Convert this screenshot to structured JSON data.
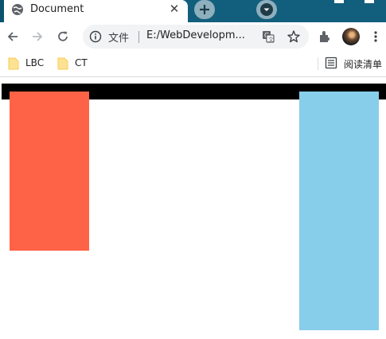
{
  "tab": {
    "title": "Document",
    "close_glyph": "✕"
  },
  "toolbar": {
    "icons": [
      "back-icon",
      "forward-icon",
      "reload-icon"
    ],
    "omnibox": {
      "chip_label": "文件",
      "url": "E:/WebDevelopm..."
    }
  },
  "bookmarks": {
    "items": [
      {
        "label": "LBC"
      },
      {
        "label": "CT"
      }
    ],
    "reading_list_label": "阅读清单"
  },
  "page": {
    "colors": {
      "bar": "#000000",
      "left_box": "#ff6347",
      "right_box": "#87ceeb"
    }
  }
}
